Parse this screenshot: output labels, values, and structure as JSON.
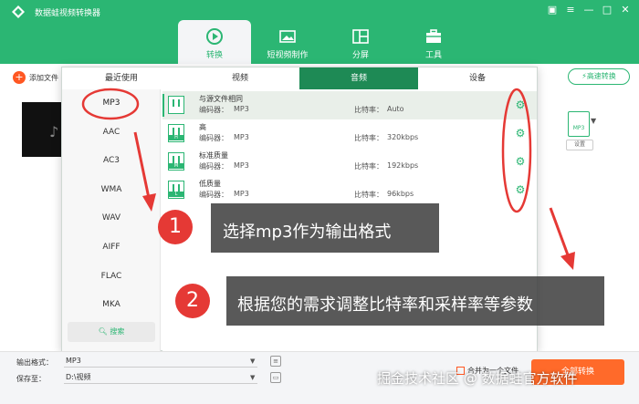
{
  "window": {
    "title": "数据蛙视频转换器",
    "buttons": [
      "▣",
      "≡",
      "—",
      "□",
      "✕"
    ]
  },
  "nav": {
    "tabs": [
      {
        "label": "转换",
        "icon": "convert-icon",
        "active": true
      },
      {
        "label": "短视频制作",
        "icon": "image-icon",
        "active": false
      },
      {
        "label": "分屏",
        "icon": "split-screen-icon",
        "active": false
      },
      {
        "label": "工具",
        "icon": "toolbox-icon",
        "active": false
      }
    ]
  },
  "main": {
    "add_file": "添加文件",
    "fast_convert": "高速转换",
    "mp3_badge": "MP3",
    "settings_label": "设置"
  },
  "popup": {
    "tabs": [
      {
        "label": "最近使用",
        "active": false
      },
      {
        "label": "视频",
        "active": false
      },
      {
        "label": "音频",
        "active": true
      },
      {
        "label": "设备",
        "active": false
      }
    ],
    "formats": [
      "MP3",
      "AAC",
      "AC3",
      "WMA",
      "WAV",
      "AIFF",
      "FLAC",
      "MKA"
    ],
    "selected_format": "MP3",
    "search_label": "搜索",
    "qualities": [
      {
        "name": "与源文件相同",
        "badge": "",
        "encoder_label": "编码器：",
        "encoder": "MP3",
        "bitrate_label": "比特率：",
        "bitrate": "Auto"
      },
      {
        "name": "高",
        "badge": "H",
        "encoder_label": "编码器：",
        "encoder": "MP3",
        "bitrate_label": "比特率：",
        "bitrate": "320kbps"
      },
      {
        "name": "标准质量",
        "badge": "M",
        "encoder_label": "编码器：",
        "encoder": "MP3",
        "bitrate_label": "比特率：",
        "bitrate": "192kbps"
      },
      {
        "name": "低质量",
        "badge": "L",
        "encoder_label": "编码器：",
        "encoder": "MP3",
        "bitrate_label": "比特率：",
        "bitrate": "96kbps"
      }
    ]
  },
  "bottom": {
    "output_format_label": "输出格式：",
    "output_format_value": "MP3",
    "save_to_label": "保存至：",
    "save_to_value": "D:\\视频",
    "merge_label": "合并为一个文件",
    "convert_all": "全部转换"
  },
  "annotations": {
    "step1_num": "1",
    "step1_text": "选择mp3作为输出格式",
    "step2_num": "2",
    "step2_text": "根据您的需求调整比特率和采样率等参数"
  },
  "watermark": "掘金技术社区 @ 数据蛙官方软件",
  "colors": {
    "brand_green": "#2bb673",
    "active_tab_green": "#1e8a55",
    "accent_orange": "#ff6a2a",
    "annotation_red": "#e53935"
  }
}
